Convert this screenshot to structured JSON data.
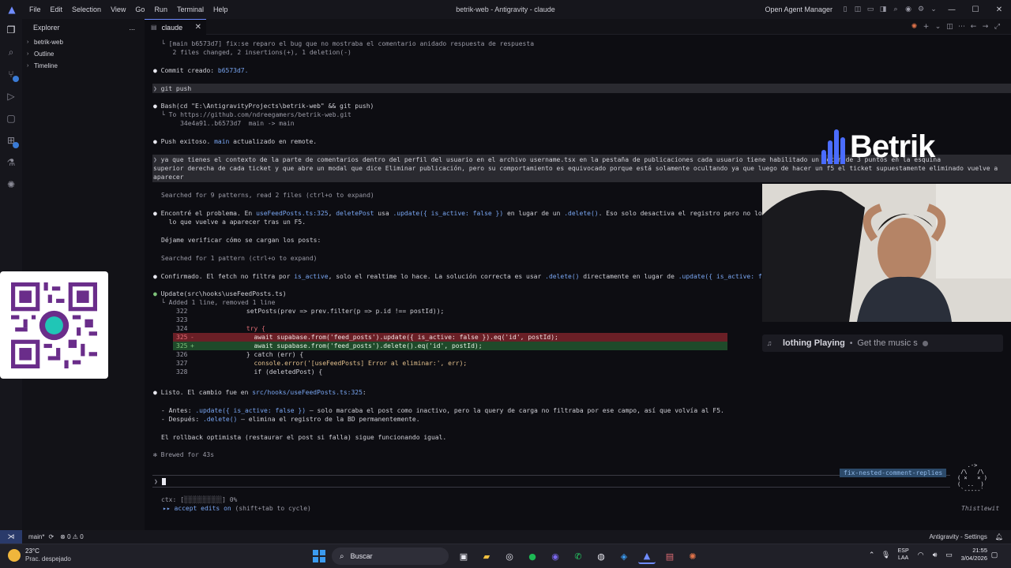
{
  "titlebar": {
    "menu": [
      "File",
      "Edit",
      "Selection",
      "View",
      "Go",
      "Run",
      "Terminal",
      "Help"
    ],
    "title": "betrik-web - Antigravity - claude",
    "agent_manager": "Open Agent Manager"
  },
  "explorer": {
    "title": "Explorer",
    "more": "...",
    "items": [
      "betrik-web",
      "Outline",
      "Timeline"
    ]
  },
  "tab": {
    "label": "claude"
  },
  "terminal": {
    "l1": "└ [main b6573d7] fix:se reparo el bug que no mostraba el comentario anidado respuesta de respuesta",
    "l2": "   2 files changed, 2 insertions(+), 1 deletion(-)",
    "commit_prefix": "Commit creado: ",
    "commit_hash": "b6573d7.",
    "git_push": "git push",
    "bash_cmd": "Bash(cd \"E:\\AntigravityProjects\\betrik-web\" && git push)",
    "push_to": "└ To https://github.com/ndreegamers/betrik-web.git",
    "push_refs": "     34e4a91..b6573d7  main -> main",
    "push_ok_1": "Push exitoso. ",
    "push_ok_branch": "main",
    "push_ok_2": " actualizado en remote.",
    "prompt_1": "ya que tienes el contexto de la parte de comentarios dentro del perfil del usuario en el archivo username.tsx en la pestaña de publicaciones cada usuario tiene habilitado un boton de 3 puntos en la esquina",
    "prompt_2": "superior derecha de cada ticket y que abre un modal que dice Eliminar publicación, pero su comportamiento es equivocado porque está solamente ocultando ya que luego de hacer un f5 el ticket supuestamente eliminado vuelve a",
    "prompt_3": "aparecer",
    "searched_1": "Searched for 9 patterns, read 2 files (ctrl+o to expand)",
    "found_1": "Encontré el problema. En ",
    "found_file": "useFeedPosts.ts:325",
    "found_2": ", ",
    "found_fn": "deletePost",
    "found_3": " usa ",
    "found_code1": ".update({ is_active: false })",
    "found_4": " en lugar de un ",
    "found_code2": ".delete()",
    "found_5": ". Eso solo desactiva el registro pero no lo borra",
    "found_6": "  lo que vuelve a aparecer tras un F5.",
    "verify": "Déjame verificar cómo se cargan los posts:",
    "searched_2": "Searched for 1 pattern (ctrl+o to expand)",
    "confirm_1": "Confirmado. El fetch no filtra por ",
    "confirm_code1": "is_active",
    "confirm_2": ", solo el realtime lo hace. La solución correcta es usar ",
    "confirm_code2": ".delete()",
    "confirm_3": " directamente en lugar de ",
    "confirm_code3": ".update({ is_active: false",
    "update_cmd": "Update(src\\hooks\\useFeedPosts.ts)",
    "update_summary": "└ Added 1 line, removed 1 line",
    "diff": [
      {
        "num": "322",
        "sign": " ",
        "code": "      setPosts(prev => prev.filter(p => p.id !== postId));"
      },
      {
        "num": "323",
        "sign": " ",
        "code": ""
      },
      {
        "num": "324",
        "sign": " ",
        "code": "      try {"
      },
      {
        "num": "325",
        "sign": "-",
        "code": "        await supabase.from('feed_posts').update({ is_active: false }).eq('id', postId);"
      },
      {
        "num": "325",
        "sign": "+",
        "code": "        await supabase.from('feed_posts').delete().eq('id', postId);"
      },
      {
        "num": "326",
        "sign": " ",
        "code": "      } catch (err) {"
      },
      {
        "num": "327",
        "sign": " ",
        "code": "        console.error('[useFeedPosts] Error al eliminar:', err);"
      },
      {
        "num": "328",
        "sign": " ",
        "code": "        if (deletedPost) {"
      }
    ],
    "done_1": "Listo. El cambio fue en ",
    "done_file": "src/hooks/useFeedPosts.ts:325",
    "done_2": ":",
    "before_label": "- Antes: ",
    "before_code": ".update({ is_active: false })",
    "before_text": " — solo marcaba el post como inactivo, pero la query de carga no filtraba por ese campo, así que volvía al F5.",
    "after_label": "- Después: ",
    "after_code": ".delete()",
    "after_text": " — elimina el registro de la BD permanentemente.",
    "rollback": "El rollback optimista (restaurar el post si falla) sigue funcionando igual.",
    "brewed": "✻ Brewed for 43s",
    "prompt_caret": "❯",
    "branch_badge": "fix-nested-comment-replies",
    "ctx": "ctx: [░░░░░░░░░░] 0%",
    "accept": "▸▸ accept edits on",
    "accept_hint": " (shift+tab to cycle)",
    "thistle": "Thistlewit",
    "ascii": "   .-> \n /\\   /\\\n( ×   × )\n(  ..  )\n `-----`"
  },
  "overlay": {
    "brand": "Betrik",
    "brand_color": "#4a6cff",
    "now_playing_title": "lothing Playing",
    "now_playing_sub": "Get the music s"
  },
  "statusbar": {
    "branch": "main*",
    "errors": "0",
    "warnings": "0",
    "settings": "Antigravity - Settings"
  },
  "taskbar": {
    "temp": "23°C",
    "condition": "Prac. despejado",
    "search": "Buscar",
    "lang_1": "ESP",
    "lang_2": "LAA",
    "time": "21:55",
    "date": "3/04/2026"
  }
}
